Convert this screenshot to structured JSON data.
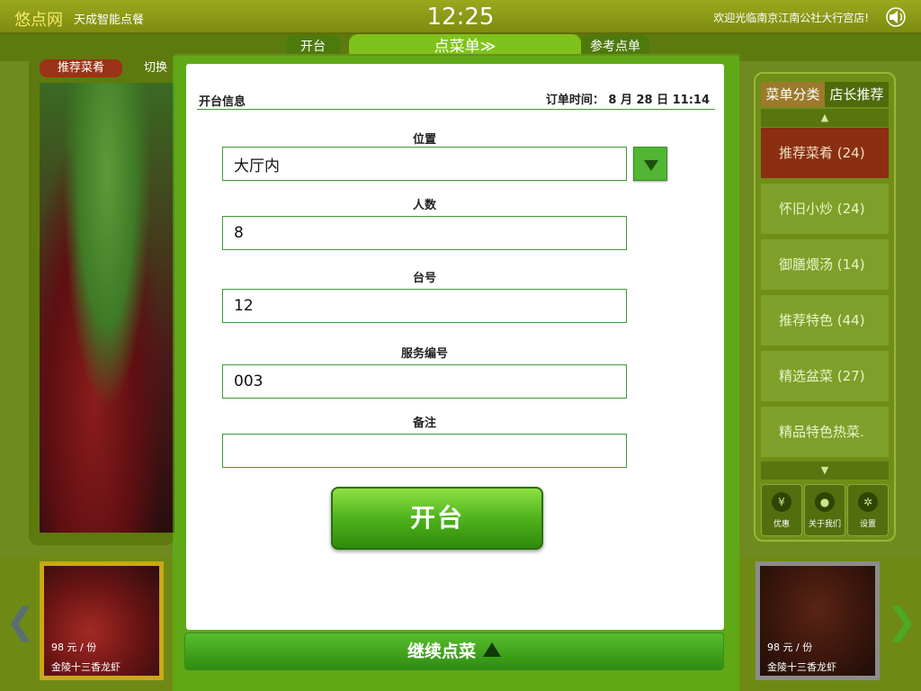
{
  "topbar": {
    "brand": "悠点网",
    "brand_sub": "天成智能点餐",
    "clock": "12:25",
    "welcome": "欢迎光临南京江南公社大行宫店!"
  },
  "tabs": {
    "open": "开台",
    "order": "点菜单≫",
    "reference": "参考点单"
  },
  "background": {
    "badge": "推荐菜肴",
    "switch": "切换",
    "side_tabs": [
      "菜单分类",
      "店长推荐"
    ],
    "categories": [
      "推荐菜肴 (24)",
      "怀旧小炒 (24)",
      "御膳煨汤 (14)",
      "推荐特色 (44)",
      "精选盆菜 (27)",
      "精品特色热菜."
    ],
    "side_buttons": [
      "优惠",
      "关于我们",
      "设置"
    ],
    "thumbs": [
      {
        "price": "98 元 / 份",
        "name": "金陵十三香龙虾"
      },
      {
        "price": "98 元 / 份",
        "name": "金陵十三香龙虾"
      }
    ]
  },
  "dialog": {
    "title": "开台信息",
    "order_time": "订单时间：  8 月 28 日  11:14",
    "fields": {
      "location": {
        "label": "位置",
        "value": "大厅内"
      },
      "guests": {
        "label": "人数",
        "value": "8"
      },
      "table": {
        "label": "台号",
        "value": "12"
      },
      "service": {
        "label": "服务编号",
        "value": "003"
      },
      "note": {
        "label": "备注",
        "value": ""
      }
    },
    "submit": "开台"
  },
  "continue_label": "继续点菜"
}
